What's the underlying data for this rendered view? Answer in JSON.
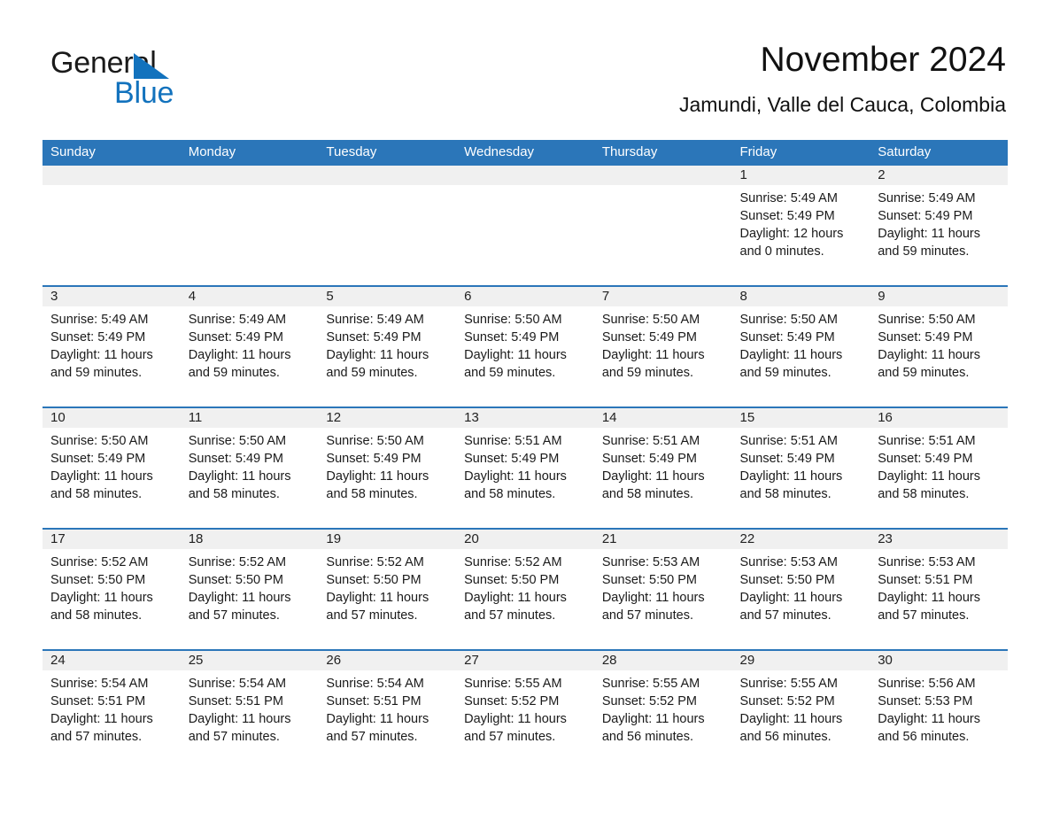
{
  "brand": {
    "name_part1": "General",
    "name_part2": "Blue",
    "logo_icon": "triangle-mark",
    "accent_color": "#1272bd"
  },
  "header": {
    "title": "November 2024",
    "subtitle": "Jamundi, Valle del Cauca, Colombia"
  },
  "calendar": {
    "header_color": "#2b76b9",
    "daynum_band_color": "#f0f0f0",
    "weekday_labels": [
      "Sunday",
      "Monday",
      "Tuesday",
      "Wednesday",
      "Thursday",
      "Friday",
      "Saturday"
    ],
    "weeks": [
      [
        {
          "day": "",
          "lines": []
        },
        {
          "day": "",
          "lines": []
        },
        {
          "day": "",
          "lines": []
        },
        {
          "day": "",
          "lines": []
        },
        {
          "day": "",
          "lines": []
        },
        {
          "day": "1",
          "lines": [
            "Sunrise: 5:49 AM",
            "Sunset: 5:49 PM",
            "Daylight: 12 hours and 0 minutes."
          ]
        },
        {
          "day": "2",
          "lines": [
            "Sunrise: 5:49 AM",
            "Sunset: 5:49 PM",
            "Daylight: 11 hours and 59 minutes."
          ]
        }
      ],
      [
        {
          "day": "3",
          "lines": [
            "Sunrise: 5:49 AM",
            "Sunset: 5:49 PM",
            "Daylight: 11 hours and 59 minutes."
          ]
        },
        {
          "day": "4",
          "lines": [
            "Sunrise: 5:49 AM",
            "Sunset: 5:49 PM",
            "Daylight: 11 hours and 59 minutes."
          ]
        },
        {
          "day": "5",
          "lines": [
            "Sunrise: 5:49 AM",
            "Sunset: 5:49 PM",
            "Daylight: 11 hours and 59 minutes."
          ]
        },
        {
          "day": "6",
          "lines": [
            "Sunrise: 5:50 AM",
            "Sunset: 5:49 PM",
            "Daylight: 11 hours and 59 minutes."
          ]
        },
        {
          "day": "7",
          "lines": [
            "Sunrise: 5:50 AM",
            "Sunset: 5:49 PM",
            "Daylight: 11 hours and 59 minutes."
          ]
        },
        {
          "day": "8",
          "lines": [
            "Sunrise: 5:50 AM",
            "Sunset: 5:49 PM",
            "Daylight: 11 hours and 59 minutes."
          ]
        },
        {
          "day": "9",
          "lines": [
            "Sunrise: 5:50 AM",
            "Sunset: 5:49 PM",
            "Daylight: 11 hours and 59 minutes."
          ]
        }
      ],
      [
        {
          "day": "10",
          "lines": [
            "Sunrise: 5:50 AM",
            "Sunset: 5:49 PM",
            "Daylight: 11 hours and 58 minutes."
          ]
        },
        {
          "day": "11",
          "lines": [
            "Sunrise: 5:50 AM",
            "Sunset: 5:49 PM",
            "Daylight: 11 hours and 58 minutes."
          ]
        },
        {
          "day": "12",
          "lines": [
            "Sunrise: 5:50 AM",
            "Sunset: 5:49 PM",
            "Daylight: 11 hours and 58 minutes."
          ]
        },
        {
          "day": "13",
          "lines": [
            "Sunrise: 5:51 AM",
            "Sunset: 5:49 PM",
            "Daylight: 11 hours and 58 minutes."
          ]
        },
        {
          "day": "14",
          "lines": [
            "Sunrise: 5:51 AM",
            "Sunset: 5:49 PM",
            "Daylight: 11 hours and 58 minutes."
          ]
        },
        {
          "day": "15",
          "lines": [
            "Sunrise: 5:51 AM",
            "Sunset: 5:49 PM",
            "Daylight: 11 hours and 58 minutes."
          ]
        },
        {
          "day": "16",
          "lines": [
            "Sunrise: 5:51 AM",
            "Sunset: 5:49 PM",
            "Daylight: 11 hours and 58 minutes."
          ]
        }
      ],
      [
        {
          "day": "17",
          "lines": [
            "Sunrise: 5:52 AM",
            "Sunset: 5:50 PM",
            "Daylight: 11 hours and 58 minutes."
          ]
        },
        {
          "day": "18",
          "lines": [
            "Sunrise: 5:52 AM",
            "Sunset: 5:50 PM",
            "Daylight: 11 hours and 57 minutes."
          ]
        },
        {
          "day": "19",
          "lines": [
            "Sunrise: 5:52 AM",
            "Sunset: 5:50 PM",
            "Daylight: 11 hours and 57 minutes."
          ]
        },
        {
          "day": "20",
          "lines": [
            "Sunrise: 5:52 AM",
            "Sunset: 5:50 PM",
            "Daylight: 11 hours and 57 minutes."
          ]
        },
        {
          "day": "21",
          "lines": [
            "Sunrise: 5:53 AM",
            "Sunset: 5:50 PM",
            "Daylight: 11 hours and 57 minutes."
          ]
        },
        {
          "day": "22",
          "lines": [
            "Sunrise: 5:53 AM",
            "Sunset: 5:50 PM",
            "Daylight: 11 hours and 57 minutes."
          ]
        },
        {
          "day": "23",
          "lines": [
            "Sunrise: 5:53 AM",
            "Sunset: 5:51 PM",
            "Daylight: 11 hours and 57 minutes."
          ]
        }
      ],
      [
        {
          "day": "24",
          "lines": [
            "Sunrise: 5:54 AM",
            "Sunset: 5:51 PM",
            "Daylight: 11 hours and 57 minutes."
          ]
        },
        {
          "day": "25",
          "lines": [
            "Sunrise: 5:54 AM",
            "Sunset: 5:51 PM",
            "Daylight: 11 hours and 57 minutes."
          ]
        },
        {
          "day": "26",
          "lines": [
            "Sunrise: 5:54 AM",
            "Sunset: 5:51 PM",
            "Daylight: 11 hours and 57 minutes."
          ]
        },
        {
          "day": "27",
          "lines": [
            "Sunrise: 5:55 AM",
            "Sunset: 5:52 PM",
            "Daylight: 11 hours and 57 minutes."
          ]
        },
        {
          "day": "28",
          "lines": [
            "Sunrise: 5:55 AM",
            "Sunset: 5:52 PM",
            "Daylight: 11 hours and 56 minutes."
          ]
        },
        {
          "day": "29",
          "lines": [
            "Sunrise: 5:55 AM",
            "Sunset: 5:52 PM",
            "Daylight: 11 hours and 56 minutes."
          ]
        },
        {
          "day": "30",
          "lines": [
            "Sunrise: 5:56 AM",
            "Sunset: 5:53 PM",
            "Daylight: 11 hours and 56 minutes."
          ]
        }
      ]
    ]
  }
}
